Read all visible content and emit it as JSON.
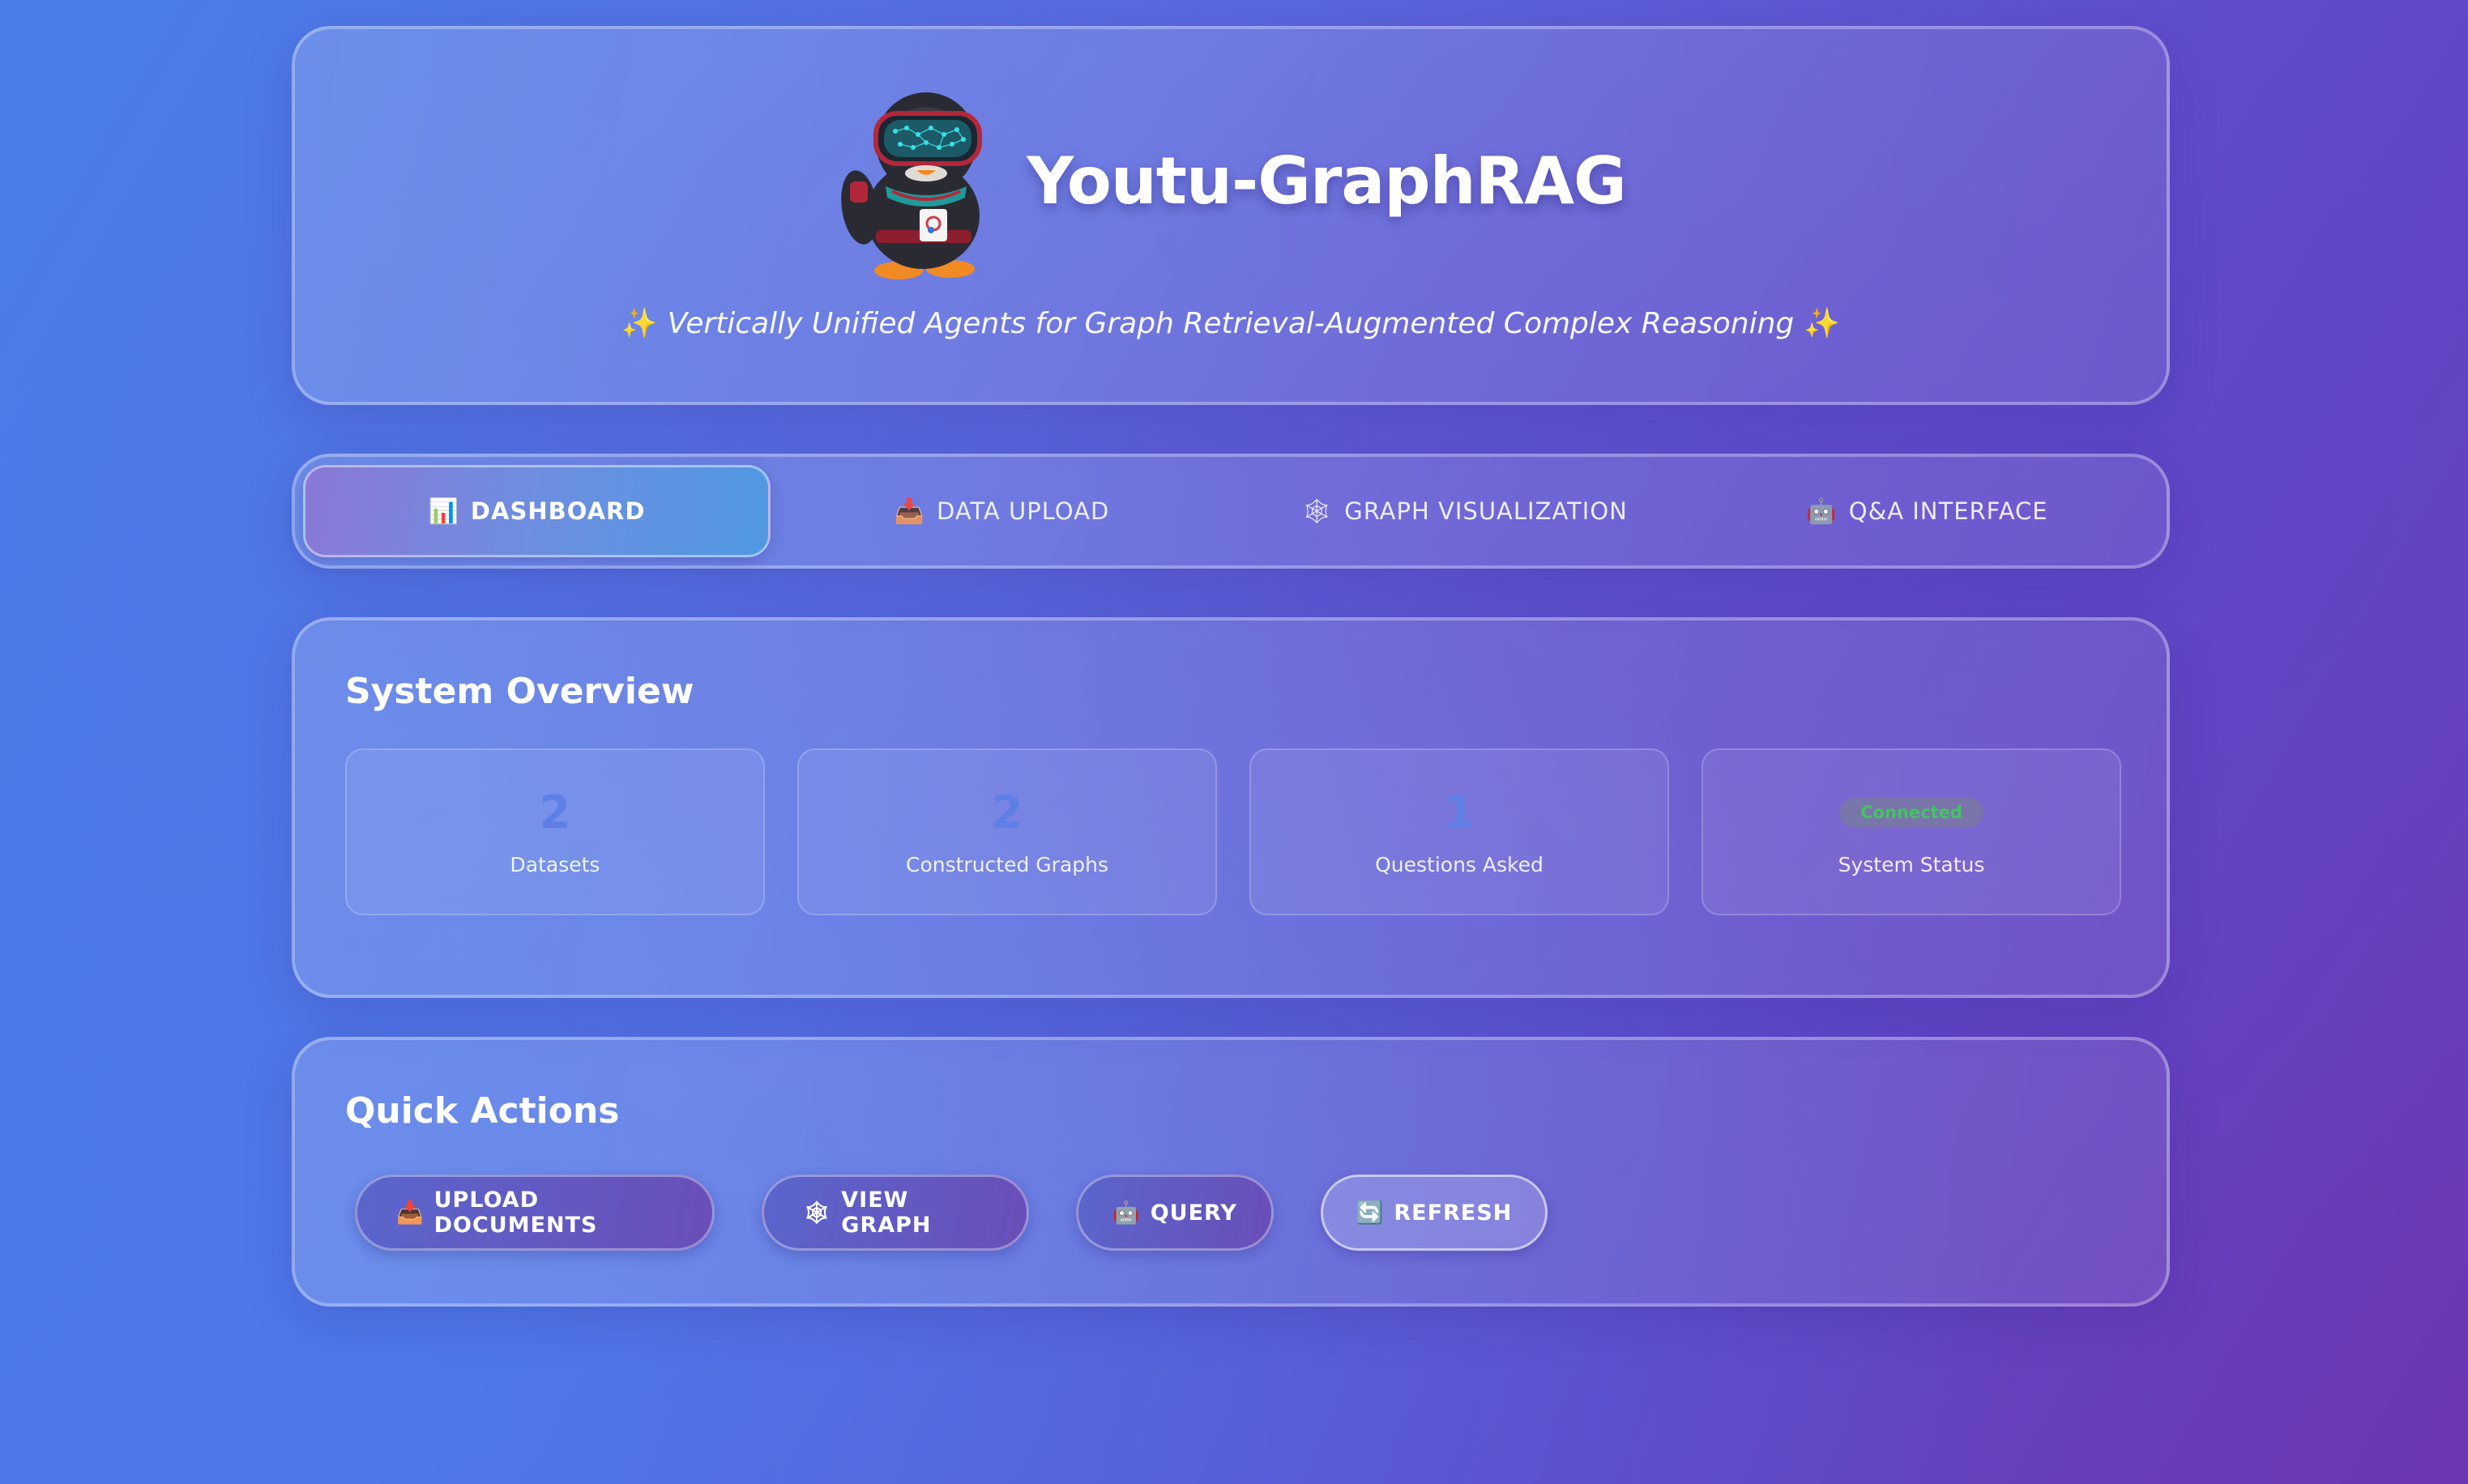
{
  "header": {
    "title": "Youtu-GraphRAG",
    "subtitle": "Vertically Unified Agents for Graph Retrieval-Augmented Complex Reasoning",
    "sparkle": "✨",
    "mascot_icon": "penguin-mascot-with-vr-goggles"
  },
  "tabs": [
    {
      "label": "Dashboard",
      "icon": "📊",
      "icon_name": "bar-chart-icon",
      "active": true
    },
    {
      "label": "Data Upload",
      "icon": "📥",
      "icon_name": "inbox-tray-icon",
      "active": false
    },
    {
      "label": "Graph Visualization",
      "icon": "🕸",
      "icon_name": "spider-web-icon",
      "active": false
    },
    {
      "label": "Q&A Interface",
      "icon": "🤖",
      "icon_name": "robot-icon",
      "active": false
    }
  ],
  "overview": {
    "title": "System Overview",
    "stats": [
      {
        "value": "2",
        "label": "Datasets"
      },
      {
        "value": "2",
        "label": "Constructed Graphs"
      },
      {
        "value": "1",
        "label": "Questions Asked"
      }
    ],
    "status": {
      "badge": "Connected",
      "label": "System Status"
    }
  },
  "actions": {
    "title": "Quick Actions",
    "buttons": [
      {
        "label": "Upload Documents",
        "icon": "📥",
        "icon_name": "inbox-tray-icon"
      },
      {
        "label": "View Graph",
        "icon": "🕸",
        "icon_name": "spider-web-icon"
      },
      {
        "label": "Query",
        "icon": "🤖",
        "icon_name": "robot-icon"
      },
      {
        "label": "Refresh",
        "icon": "🔄",
        "icon_name": "refresh-icon"
      }
    ]
  },
  "colors": {
    "accent_value": "#5f7fe6",
    "status_green": "#43c463",
    "background_start": "#4a7ee9",
    "background_end": "#6c36b2"
  }
}
